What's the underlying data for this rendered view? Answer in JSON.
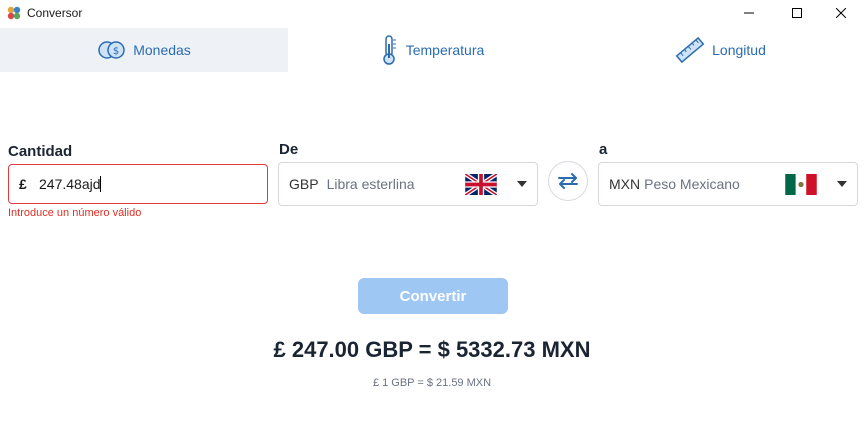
{
  "window": {
    "title": "Conversor"
  },
  "tabs": [
    {
      "label": "Monedas",
      "icon": "coins-icon",
      "active": true
    },
    {
      "label": "Temperatura",
      "icon": "thermometer-icon",
      "active": false
    },
    {
      "label": "Longitud",
      "icon": "ruler-icon",
      "active": false
    }
  ],
  "form": {
    "amount_label": "Cantidad",
    "amount_symbol": "£",
    "amount_value": "247.48ajd",
    "error_message": "Introduce un número válido",
    "from_label": "De",
    "from_code": "GBP",
    "from_name": "Libra esterlina",
    "from_flag": "uk-flag-icon",
    "to_label": "a",
    "to_code": "MXN",
    "to_name": "Peso Mexicano",
    "to_flag": "mexico-flag-icon",
    "swap_icon": "swap-arrows-icon"
  },
  "convert_button": "Convertir",
  "result": {
    "text": "£ 247.00 GBP = $ 5332.73 MXN",
    "rate_text": "£ 1 GBP = $ 21.59 MXN"
  },
  "colors": {
    "accent": "#2b6cb0",
    "error": "#e03c3c",
    "button_disabled": "#9ec7f3",
    "active_tab_bg": "#eef2f6"
  }
}
